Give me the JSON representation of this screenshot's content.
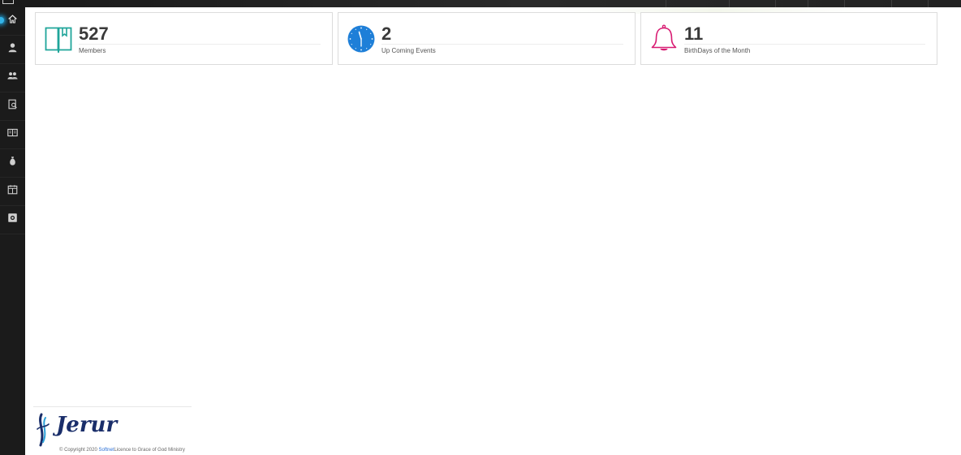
{
  "sidebar": {
    "items": [
      {
        "id": "dashboard",
        "icon": "home-icon",
        "active": true
      },
      {
        "id": "profile",
        "icon": "user-icon",
        "active": false
      },
      {
        "id": "members",
        "icon": "users-group-icon",
        "active": false
      },
      {
        "id": "records",
        "icon": "document-search-icon",
        "active": false
      },
      {
        "id": "bible",
        "icon": "open-book-icon",
        "active": false
      },
      {
        "id": "donations",
        "icon": "money-bag-icon",
        "active": false
      },
      {
        "id": "calendar",
        "icon": "calendar-icon",
        "active": false
      },
      {
        "id": "gallery",
        "icon": "photo-icon",
        "active": false
      }
    ]
  },
  "cards": [
    {
      "number": "527",
      "label": "Members",
      "icon": "book-icon",
      "color": "#1fa59a"
    },
    {
      "number": "2",
      "label": "Up Coming Events",
      "icon": "clock-icon",
      "color": "#1e7fd8"
    },
    {
      "number": "11",
      "label": "BirthDays of the Month",
      "icon": "bell-icon",
      "color": "#d81b72"
    }
  ],
  "footer": {
    "logo_text": "Jerur",
    "copyright_prefix": "© Copyright 2020",
    "company_link": "Softnet",
    "copyright_suffix": "Licence to Grace of God Ministry"
  }
}
